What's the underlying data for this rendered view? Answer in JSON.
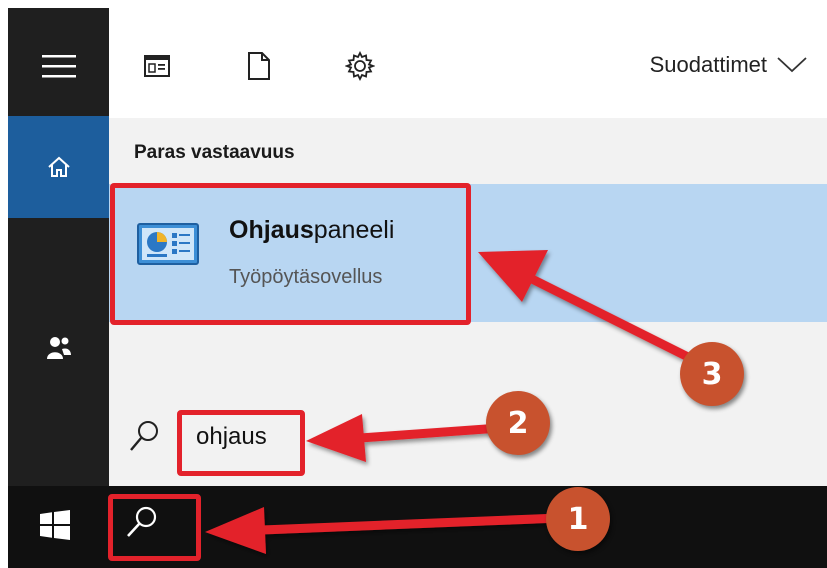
{
  "toolbar": {
    "filters_label": "Suodattimet"
  },
  "best_match": {
    "heading": "Paras vastaavuus",
    "title_bold": "Ohjaus",
    "title_rest": "paneeli",
    "subtitle": "Työpöytäsovellus"
  },
  "search": {
    "query": "ohjaus"
  },
  "annotations": {
    "step1": "1",
    "step2": "2",
    "step3": "3"
  },
  "colors": {
    "rail": "#1f1f1f",
    "home_active": "#1d5e9d",
    "result_highlight": "#b8d6f2",
    "annotation_red": "#e3222b",
    "badge": "#c8522e"
  }
}
